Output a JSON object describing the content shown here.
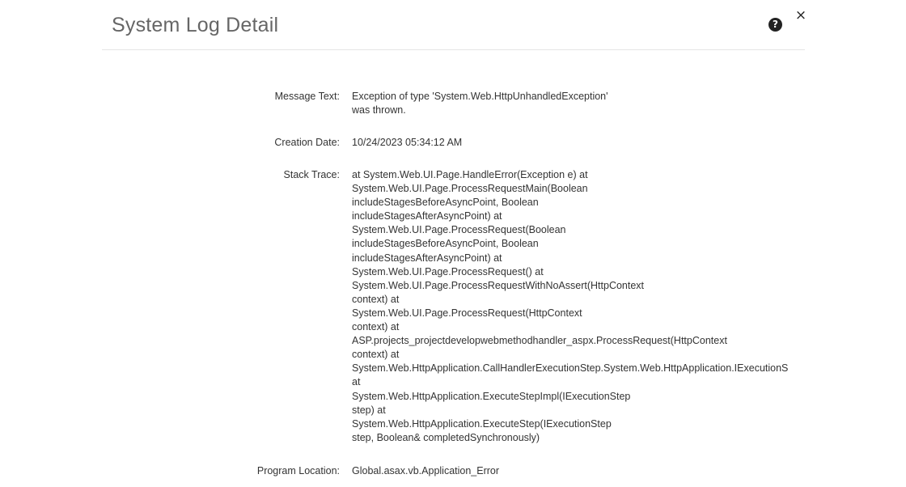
{
  "header": {
    "title": "System Log Detail",
    "help_icon_glyph": "?",
    "close_icon_glyph": "×"
  },
  "fields": {
    "message_text": {
      "label": "Message Text:",
      "lines": [
        "Exception of type 'System.Web.HttpUnhandledException'",
        "was thrown."
      ]
    },
    "creation_date": {
      "label": "Creation Date:",
      "value": "10/24/2023 05:34:12 AM"
    },
    "stack_trace": {
      "label": "Stack Trace:",
      "lines": [
        "at System.Web.UI.Page.HandleError(Exception e) at",
        "System.Web.UI.Page.ProcessRequestMain(Boolean",
        "includeStagesBeforeAsyncPoint, Boolean",
        "includeStagesAfterAsyncPoint) at",
        "System.Web.UI.Page.ProcessRequest(Boolean",
        "includeStagesBeforeAsyncPoint, Boolean",
        "includeStagesAfterAsyncPoint) at",
        "System.Web.UI.Page.ProcessRequest() at",
        "System.Web.UI.Page.ProcessRequestWithNoAssert(HttpContext",
        "context) at",
        "System.Web.UI.Page.ProcessRequest(HttpContext",
        "context) at",
        "ASP.projects_projectdevelopwebmethodhandler_aspx.ProcessRequest(HttpContext",
        "context) at",
        "System.Web.HttpApplication.CallHandlerExecutionStep.System.Web.HttpApplication.IExecutionS",
        "at",
        "System.Web.HttpApplication.ExecuteStepImpl(IExecutionStep",
        "step) at",
        "System.Web.HttpApplication.ExecuteStep(IExecutionStep",
        "step, Boolean& completedSynchronously)"
      ]
    },
    "program_location": {
      "label": "Program Location:",
      "value": "Global.asax.vb.Application_Error"
    }
  }
}
